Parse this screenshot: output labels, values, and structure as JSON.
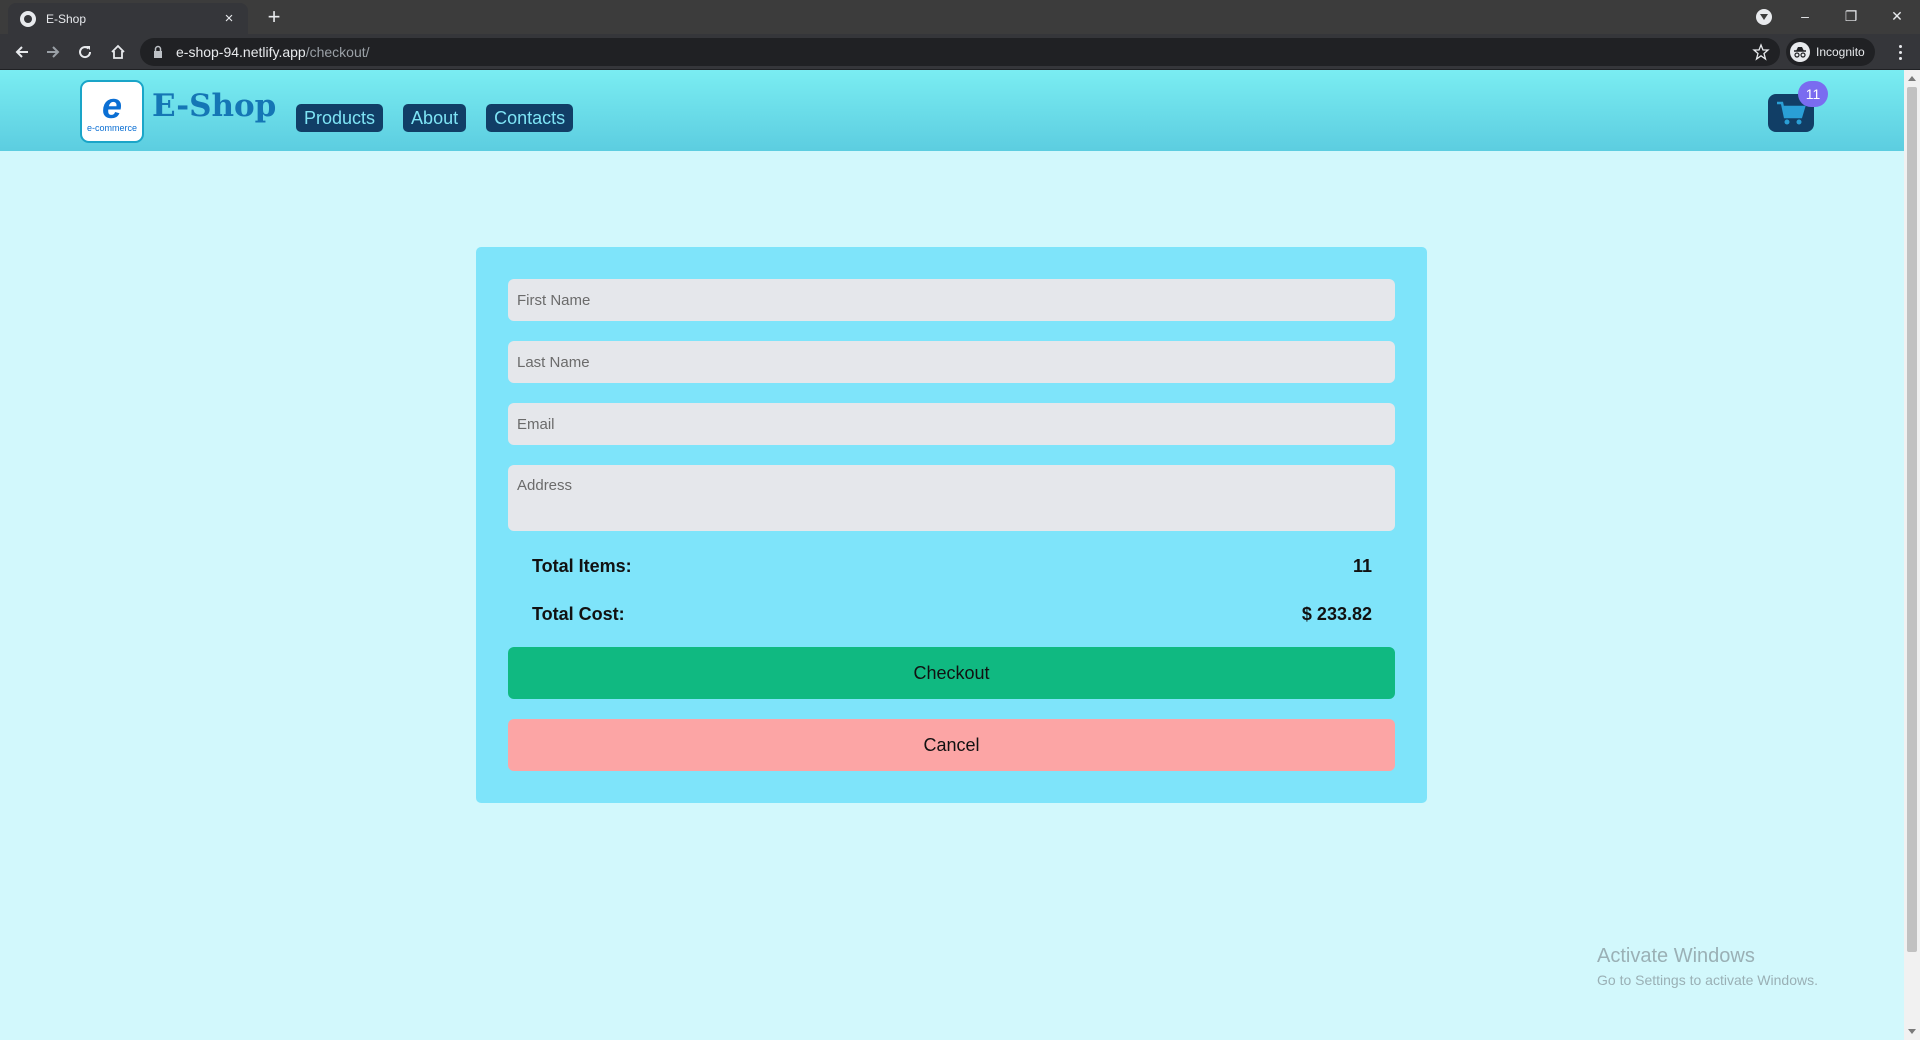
{
  "browser": {
    "tab_title": "E-Shop",
    "tab_close": "×",
    "new_tab": "+",
    "url_host": "e-shop-94.netlify.app",
    "url_path": "/checkout/",
    "profile_label": "Incognito",
    "window_controls": {
      "minimize": "–",
      "restore": "❐",
      "close": "✕"
    }
  },
  "header": {
    "logo_letter": "e",
    "logo_caption": "e-commerce",
    "brand": "E-Shop",
    "nav": [
      {
        "label": "Products"
      },
      {
        "label": "About"
      },
      {
        "label": "Contacts"
      }
    ],
    "cart_count": "11"
  },
  "checkout_form": {
    "first_name_placeholder": "First Name",
    "last_name_placeholder": "Last Name",
    "email_placeholder": "Email",
    "address_placeholder": "Address",
    "total_items_label": "Total Items:",
    "total_items_value": "11",
    "total_cost_label": "Total Cost:",
    "total_cost_value": "$ 233.82",
    "checkout_label": "Checkout",
    "cancel_label": "Cancel"
  },
  "watermark": {
    "title": "Activate Windows",
    "subtitle": "Go to Settings to activate Windows."
  },
  "colors": {
    "page_bg": "#d2f8fc",
    "card_bg": "#7ee4fa",
    "nav_link_bg": "#113e66",
    "checkout_btn": "#10b981",
    "cancel_btn": "#fca5a5",
    "badge": "#7a6cf0"
  }
}
